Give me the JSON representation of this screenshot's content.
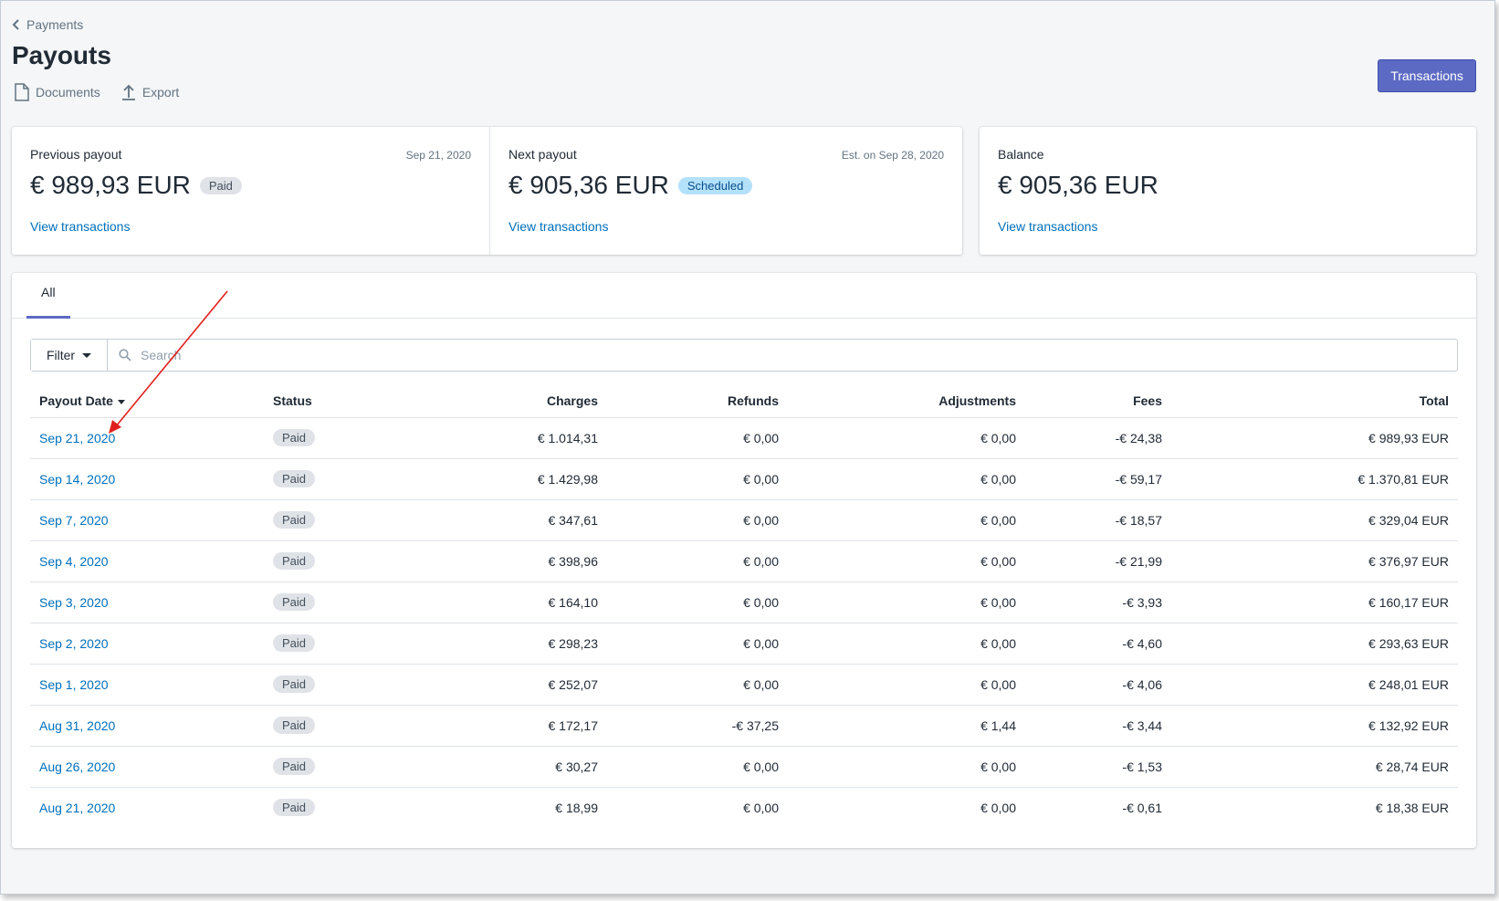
{
  "breadcrumb": {
    "label": "Payments"
  },
  "page": {
    "title": "Payouts",
    "actions": {
      "documents": "Documents",
      "export": "Export"
    },
    "primary_button": "Transactions"
  },
  "summary": {
    "previous": {
      "label": "Previous payout",
      "date": "Sep 21, 2020",
      "amount": "€ 989,93 EUR",
      "badge": "Paid",
      "link": "View transactions"
    },
    "next": {
      "label": "Next payout",
      "date": "Est. on Sep 28, 2020",
      "amount": "€ 905,36 EUR",
      "badge": "Scheduled",
      "link": "View transactions"
    },
    "balance": {
      "label": "Balance",
      "amount": "€ 905,36 EUR",
      "link": "View transactions"
    }
  },
  "tabs": [
    "All"
  ],
  "filter": {
    "label": "Filter",
    "search_placeholder": "Search"
  },
  "table": {
    "headers": {
      "date": "Payout Date",
      "status": "Status",
      "charges": "Charges",
      "refunds": "Refunds",
      "adjustments": "Adjustments",
      "fees": "Fees",
      "total": "Total"
    },
    "rows": [
      {
        "date": "Sep 21, 2020",
        "status": "Paid",
        "charges": "€ 1.014,31",
        "refunds": "€ 0,00",
        "adjustments": "€ 0,00",
        "fees": "-€ 24,38",
        "total": "€ 989,93 EUR"
      },
      {
        "date": "Sep 14, 2020",
        "status": "Paid",
        "charges": "€ 1.429,98",
        "refunds": "€ 0,00",
        "adjustments": "€ 0,00",
        "fees": "-€ 59,17",
        "total": "€ 1.370,81 EUR"
      },
      {
        "date": "Sep 7, 2020",
        "status": "Paid",
        "charges": "€ 347,61",
        "refunds": "€ 0,00",
        "adjustments": "€ 0,00",
        "fees": "-€ 18,57",
        "total": "€ 329,04 EUR"
      },
      {
        "date": "Sep 4, 2020",
        "status": "Paid",
        "charges": "€ 398,96",
        "refunds": "€ 0,00",
        "adjustments": "€ 0,00",
        "fees": "-€ 21,99",
        "total": "€ 376,97 EUR"
      },
      {
        "date": "Sep 3, 2020",
        "status": "Paid",
        "charges": "€ 164,10",
        "refunds": "€ 0,00",
        "adjustments": "€ 0,00",
        "fees": "-€ 3,93",
        "total": "€ 160,17 EUR"
      },
      {
        "date": "Sep 2, 2020",
        "status": "Paid",
        "charges": "€ 298,23",
        "refunds": "€ 0,00",
        "adjustments": "€ 0,00",
        "fees": "-€ 4,60",
        "total": "€ 293,63 EUR"
      },
      {
        "date": "Sep 1, 2020",
        "status": "Paid",
        "charges": "€ 252,07",
        "refunds": "€ 0,00",
        "adjustments": "€ 0,00",
        "fees": "-€ 4,06",
        "total": "€ 248,01 EUR"
      },
      {
        "date": "Aug 31, 2020",
        "status": "Paid",
        "charges": "€ 172,17",
        "refunds": "-€ 37,25",
        "adjustments": "€ 1,44",
        "fees": "-€ 3,44",
        "total": "€ 132,92 EUR"
      },
      {
        "date": "Aug 26, 2020",
        "status": "Paid",
        "charges": "€ 30,27",
        "refunds": "€ 0,00",
        "adjustments": "€ 0,00",
        "fees": "-€ 1,53",
        "total": "€ 28,74 EUR"
      },
      {
        "date": "Aug 21, 2020",
        "status": "Paid",
        "charges": "€ 18,99",
        "refunds": "€ 0,00",
        "adjustments": "€ 0,00",
        "fees": "-€ 0,61",
        "total": "€ 18,38 EUR"
      }
    ]
  },
  "colors": {
    "primary": "#5c6ac4",
    "link": "#006fbb",
    "annotation": "#e0201e",
    "scheduled_badge": "#b4e1fa"
  },
  "icons": {
    "back": "chevron-left-icon",
    "documents": "document-icon",
    "export": "export-icon",
    "search": "search-icon",
    "filter_caret": "caret-down-icon"
  }
}
